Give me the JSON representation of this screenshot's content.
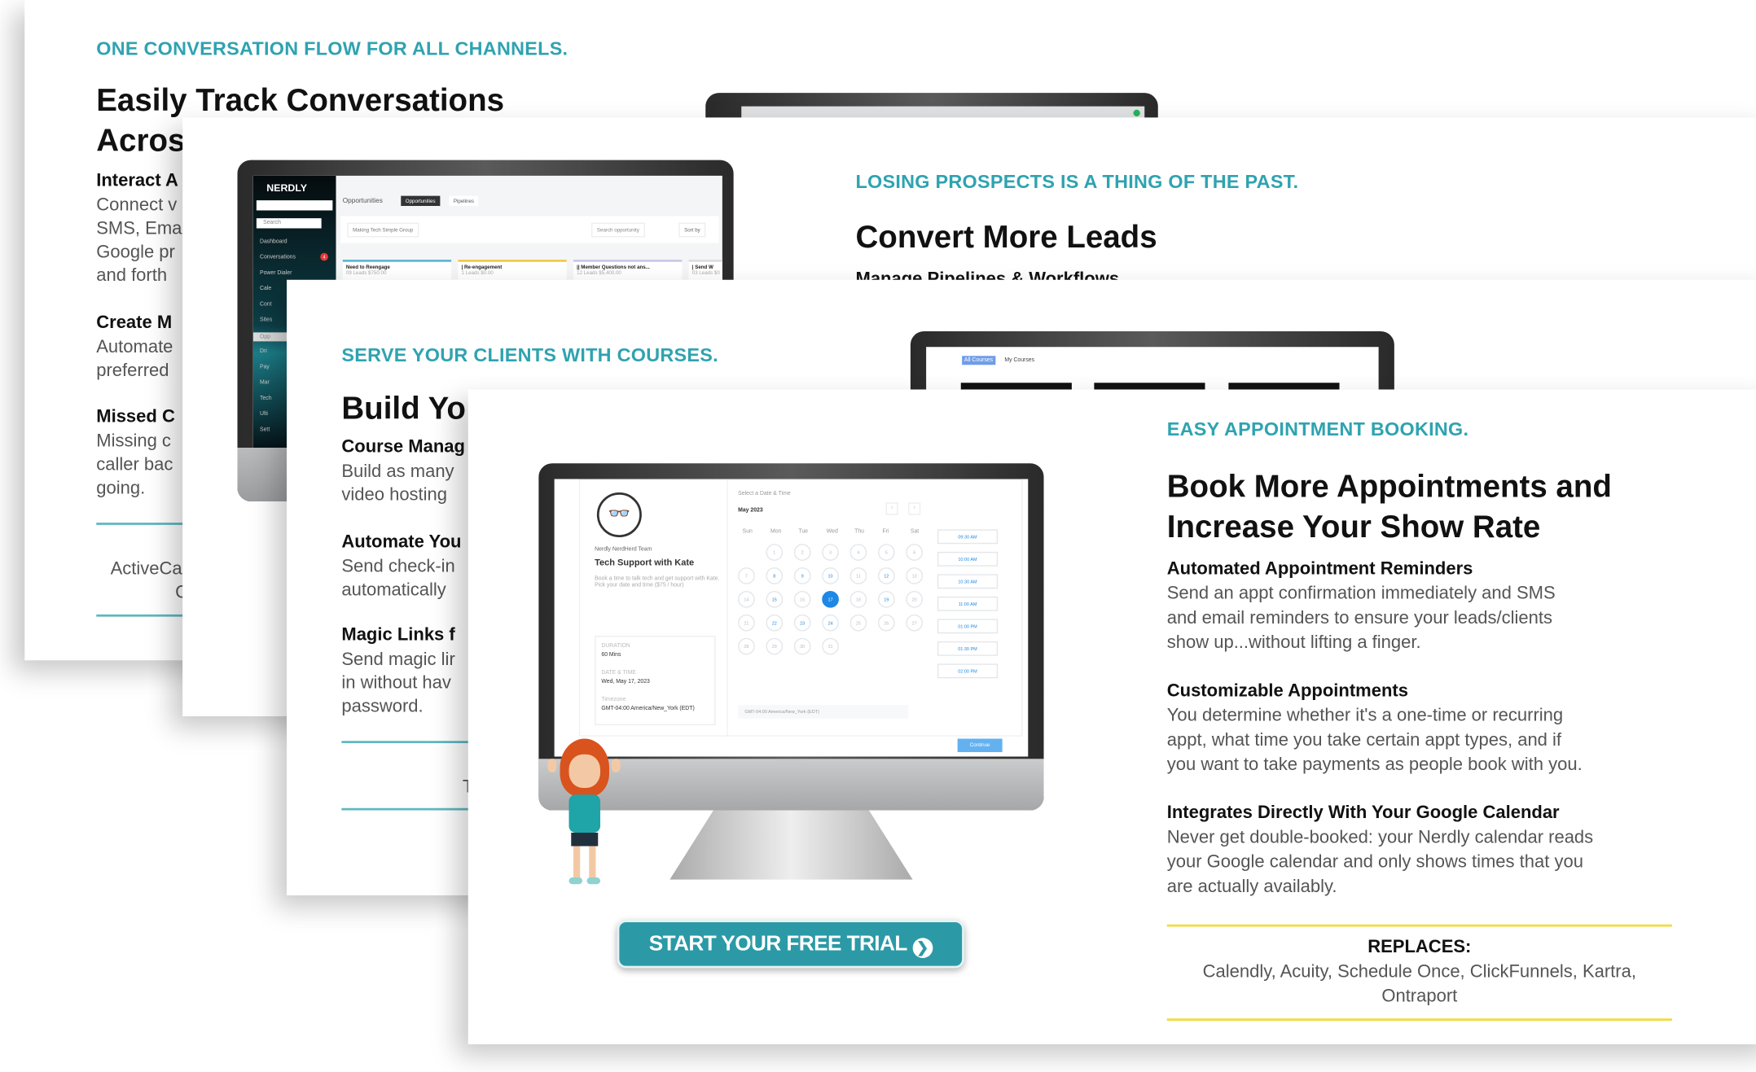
{
  "card1": {
    "kicker": "ONE CONVERSATION FLOW FOR ALL CHANNELS.",
    "title_lines": [
      "Easily Track Conversations",
      "Acros"
    ],
    "features": [
      {
        "title": "Interact A",
        "lines": [
          "Connect v",
          "SMS, Ema",
          "Google pr",
          "and forth"
        ]
      },
      {
        "title": "Create M",
        "lines": [
          "Automate",
          "preferred"
        ]
      },
      {
        "title": "Missed C",
        "lines": [
          "Missing c",
          "caller bac",
          "going."
        ]
      }
    ],
    "replaces_lines": [
      "ActiveCar",
      "C"
    ]
  },
  "card2": {
    "kicker": "LOSING PROSPECTS IS A THING OF THE PAST.",
    "title": "Convert More Leads",
    "subtitle": "Manage Pipelines & Workflows",
    "app": {
      "logo": "NERDLY",
      "search_placeholder": "Search",
      "sidebar": [
        "Dashboard",
        "Conversations",
        "Power Dialer",
        "Cale",
        "Cont",
        "Sites",
        "Opp",
        "Dri",
        "Pay",
        "Mar",
        "Tech",
        "Ulti",
        "Sett"
      ],
      "conversations_badge": "4",
      "page_title": "Opportunities",
      "tabs": [
        "Opportunities",
        "Pipelines"
      ],
      "pipeline": "Making Tech Simple Group",
      "search_opportunity": "Search opportunity",
      "sort": "Sort by",
      "stages": [
        {
          "name": "Need to Reengage",
          "meta": "09 Leads  $750.00",
          "color": "#5fb7d6"
        },
        {
          "name": "| Re-engagement",
          "meta": "1 Leads  $0.00",
          "color": "#f2c94c"
        },
        {
          "name": "|| Member Questions not ans...",
          "meta": "12 Leads  $5,400.00",
          "color": "#c9c9e8"
        },
        {
          "name": "| Send W",
          "meta": "03 Leads  $0",
          "color": "#dddddd"
        }
      ]
    }
  },
  "card3": {
    "kicker": "SERVE YOUR CLIENTS WITH COURSES.",
    "title": "Build Yo",
    "features": [
      {
        "title": "Course Manag",
        "lines": [
          "Build as many",
          "video hosting"
        ]
      },
      {
        "title": "Automate You",
        "lines": [
          "Send check-in",
          "automatically"
        ]
      },
      {
        "title": "Magic Links f",
        "lines": [
          "Send magic lir",
          "in without hav",
          "password."
        ]
      }
    ],
    "replaces": "T",
    "app": {
      "tabs": [
        "All Courses",
        "My Courses"
      ]
    }
  },
  "card4": {
    "kicker": "EASY APPOINTMENT BOOKING.",
    "title_lines": [
      "Book More Appointments and",
      "Increase Your Show Rate"
    ],
    "features": [
      {
        "title": "Automated Appointment Reminders",
        "lines": [
          "Send an appt confirmation immediately and SMS",
          "and email reminders to ensure your leads/clients",
          "show up...without lifting a finger."
        ]
      },
      {
        "title": "Customizable Appointments",
        "lines": [
          "You determine whether it's a one-time or recurring",
          "appt, what time you take certain appt types, and if",
          "you want to take payments as people book with you."
        ]
      },
      {
        "title": "Integrates Directly With Your Google Calendar",
        "lines": [
          "Never get double-booked: your Nerdly calendar reads",
          "your Google calendar and only shows times that you",
          "are actually availably."
        ]
      }
    ],
    "replaces_label": "REPLACES:",
    "replaces_lines": [
      "Calendly, Acuity, Schedule Once, ClickFunnels, Kartra,",
      "Ontraport"
    ],
    "cta": "START YOUR FREE TRIAL",
    "cta_icon": "chevron-circle-right-icon",
    "booking": {
      "team": "Nerdly NerdHerd Team",
      "event": "Tech Support with Kate",
      "description": [
        "Book a time to talk tech and get support with Kate.",
        "Pick your date and time ($75 / hour)"
      ],
      "duration_label": "DURATION",
      "duration": "60 Mins",
      "datetime_label": "DATE & TIME",
      "datetime": "Wed, May 17, 2023",
      "timezone_label": "Timezone",
      "timezone": "GMT-04:00 America/New_York (EDT)",
      "select_label": "Select a Date & Time",
      "month": "May 2023",
      "weekdays": [
        "Sun",
        "Mon",
        "Tue",
        "Wed",
        "Thu",
        "Fri",
        "Sat"
      ],
      "first_weekday": 1,
      "days_in_month": 31,
      "available": [
        8,
        9,
        10,
        12,
        15,
        19,
        22,
        23,
        24
      ],
      "selected": 17,
      "times": [
        "09:30 AM",
        "10:00 AM",
        "10:30 AM",
        "11:00 AM",
        "01:00 PM",
        "01:30 PM",
        "02:00 PM"
      ],
      "timezone_select": "GMT-04:00 America/New_York (EDT)",
      "continue": "Continue"
    }
  },
  "colors": {
    "accent": "#2fa3b0",
    "cta": "#2b9aa6",
    "rule_yellow": "#f2dc3a",
    "calendar_blue": "#1e88e5"
  }
}
